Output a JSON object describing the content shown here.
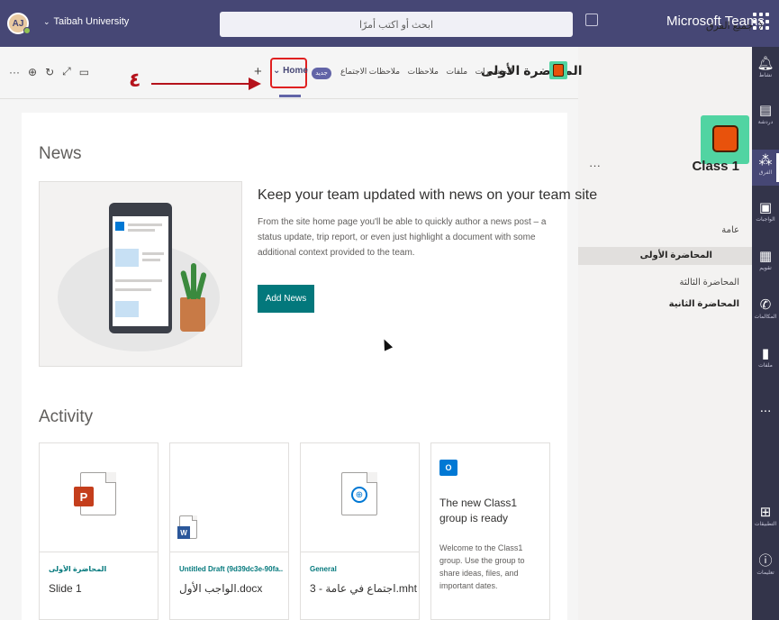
{
  "titlebar": {
    "avatar_initials": "AJ",
    "org_name": "Taibah University",
    "search_placeholder": "ابحث أو اكتب أمرًا",
    "app_title": "Microsoft Teams"
  },
  "rail": {
    "items": [
      {
        "label": "نشاط",
        "icon": "bell-icon"
      },
      {
        "label": "دردشة",
        "icon": "chat-icon"
      },
      {
        "label": "الفرق",
        "icon": "teams-icon"
      },
      {
        "label": "الواجبات",
        "icon": "assignments-icon"
      },
      {
        "label": "تقويم",
        "icon": "calendar-icon"
      },
      {
        "label": "المكالمات",
        "icon": "calls-icon"
      },
      {
        "label": "ملفات",
        "icon": "files-icon"
      },
      {
        "label": "...",
        "icon": "more-icon"
      },
      {
        "label": "التطبيقات",
        "icon": "apps-icon"
      },
      {
        "label": "تعليمات",
        "icon": "help-icon"
      }
    ]
  },
  "team_panel": {
    "all_teams": "جميع الفرق",
    "team_name": "Class 1",
    "more": "···",
    "channels": [
      {
        "label": "عامة"
      },
      {
        "label": "المحاضرة الأولى"
      },
      {
        "label": "المحاضرة الثالثة"
      },
      {
        "label": "المحاضرة الثانية"
      }
    ]
  },
  "header": {
    "channel_title": "المحاضرة الأولى",
    "tabs": [
      "المنشورات",
      "ملفات",
      "ملاحظات",
      "ملاحظات الاجتماع"
    ],
    "new_badge": "جديد",
    "home_tab": "Home",
    "add_tab": "+",
    "tools": [
      "···",
      "⊕",
      "↻",
      "⤢",
      "▭"
    ]
  },
  "annotation": {
    "number": "٤",
    "color": "#b5121b"
  },
  "news": {
    "section_title": "News",
    "heading": "Keep your team updated with news on your team site",
    "body": "From the site home page you'll be able to quickly author a news post – a status update, trip report, or even just highlight a document with some additional context provided to the team.",
    "button": "Add News"
  },
  "activity": {
    "section_title": "Activity",
    "cards": [
      {
        "site": "المحاضرة الأولى",
        "file": "Slide 1",
        "icon": "powerpoint-file-icon"
      },
      {
        "site": "Untitled Draft (9d39dc3e-90fa...",
        "file": "الواجب الأول.docx",
        "icon": "word-file-icon"
      },
      {
        "site": "General",
        "file": "اجتماع في عامة - 3.mht",
        "icon": "web-file-icon"
      }
    ],
    "group_card": {
      "title": "The new Class1 group is ready",
      "body": "Welcome to the Class1 group. Use the group to share ideas, files, and important dates.",
      "icon": "outlook-group-icon"
    }
  },
  "colors": {
    "titlebar": "#464775",
    "rail": "#33344a",
    "accent": "#6264a7",
    "teal_button": "#03787c"
  }
}
